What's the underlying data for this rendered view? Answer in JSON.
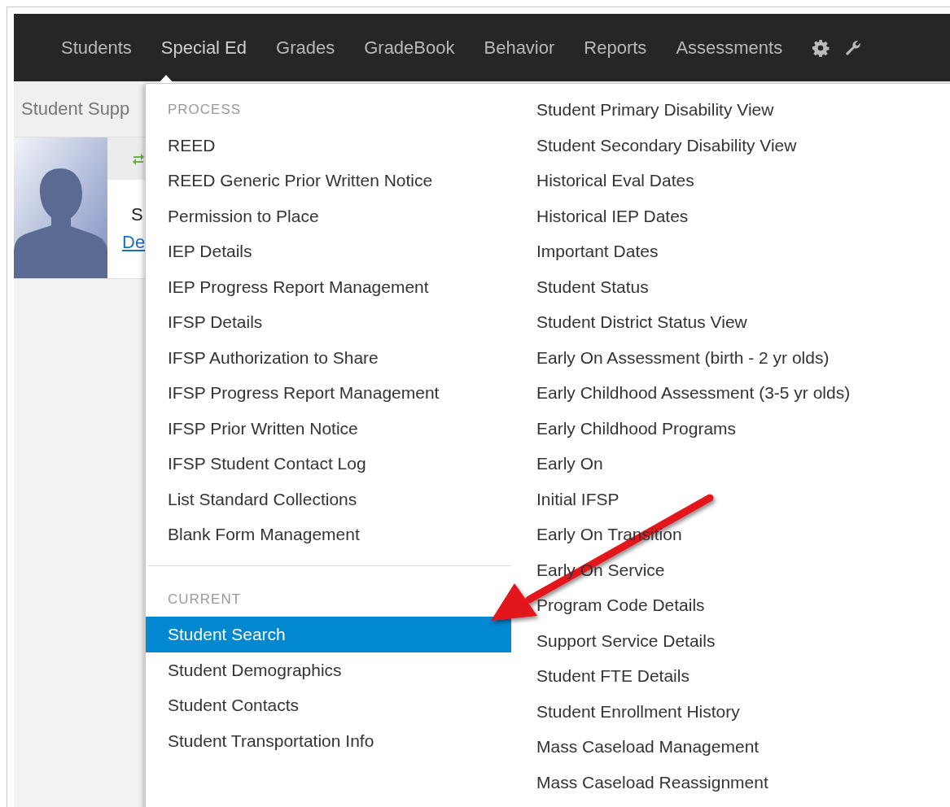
{
  "nav": {
    "items": [
      {
        "label": "Students",
        "selected": false
      },
      {
        "label": "Special Ed",
        "selected": true
      },
      {
        "label": "Grades",
        "selected": false
      },
      {
        "label": "GradeBook",
        "selected": false
      },
      {
        "label": "Behavior",
        "selected": false
      },
      {
        "label": "Reports",
        "selected": false
      },
      {
        "label": "Assessments",
        "selected": false
      }
    ]
  },
  "page": {
    "header_title": "Student Supp",
    "student_name": "S",
    "link": "De"
  },
  "menu": {
    "sections": [
      {
        "heading": "PROCESS",
        "items": [
          {
            "label": "REED",
            "selected": false
          },
          {
            "label": "REED Generic Prior Written Notice",
            "selected": false
          },
          {
            "label": "Permission to Place",
            "selected": false
          },
          {
            "label": "IEP Details",
            "selected": false
          },
          {
            "label": "IEP Progress Report Management",
            "selected": false
          },
          {
            "label": "IFSP Details",
            "selected": false
          },
          {
            "label": "IFSP Authorization to Share",
            "selected": false
          },
          {
            "label": "IFSP Progress Report Management",
            "selected": false
          },
          {
            "label": "IFSP Prior Written Notice",
            "selected": false
          },
          {
            "label": "IFSP Student Contact Log",
            "selected": false
          },
          {
            "label": "List Standard Collections",
            "selected": false
          },
          {
            "label": "Blank Form Management",
            "selected": false
          }
        ]
      },
      {
        "heading": "CURRENT",
        "items": [
          {
            "label": "Student Search",
            "selected": true
          },
          {
            "label": "Student Demographics",
            "selected": false
          },
          {
            "label": "Student Contacts",
            "selected": false
          },
          {
            "label": "Student Transportation Info",
            "selected": false
          }
        ]
      }
    ],
    "column_2": [
      {
        "label": "Student Primary Disability View",
        "selected": false
      },
      {
        "label": "Student Secondary Disability View",
        "selected": false
      },
      {
        "label": "Historical Eval Dates",
        "selected": false
      },
      {
        "label": "Historical IEP Dates",
        "selected": false
      },
      {
        "label": "Important Dates",
        "selected": false
      },
      {
        "label": "Student Status",
        "selected": false
      },
      {
        "label": "Student District Status View",
        "selected": false
      },
      {
        "label": "Early On Assessment (birth - 2 yr olds)",
        "selected": false
      },
      {
        "label": "Early Childhood Assessment (3-5 yr olds)",
        "selected": false
      },
      {
        "label": "Early Childhood Programs",
        "selected": false
      },
      {
        "label": "Early On",
        "selected": false
      },
      {
        "label": "Initial IFSP",
        "selected": false
      },
      {
        "label": "Early On Transition",
        "selected": false
      },
      {
        "label": "Early On Service",
        "selected": false
      },
      {
        "label": "Program Code Details",
        "selected": false
      },
      {
        "label": "Support Service Details",
        "selected": false
      },
      {
        "label": "Student FTE Details",
        "selected": false
      },
      {
        "label": "Student Enrollment History",
        "selected": false
      },
      {
        "label": "Mass Caseload Management",
        "selected": false
      },
      {
        "label": "Mass Caseload Reassignment",
        "selected": false
      }
    ]
  }
}
